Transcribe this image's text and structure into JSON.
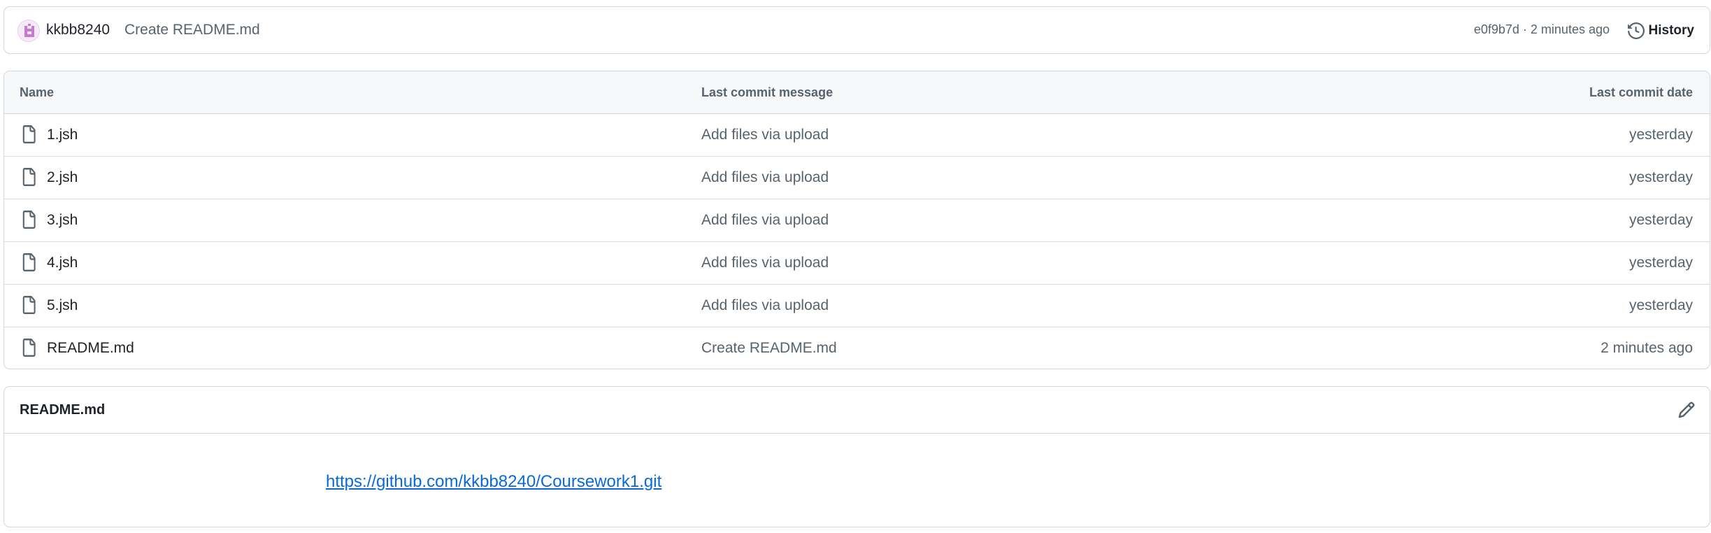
{
  "commit": {
    "author": "kkbb8240",
    "message": "Create README.md",
    "meta": "e0f9b7d · 2 minutes ago",
    "history_label": "History"
  },
  "table": {
    "headers": {
      "name": "Name",
      "message": "Last commit message",
      "date": "Last commit date"
    },
    "rows": [
      {
        "name": "1.jsh",
        "message": "Add files via upload",
        "date": "yesterday"
      },
      {
        "name": "2.jsh",
        "message": "Add files via upload",
        "date": "yesterday"
      },
      {
        "name": "3.jsh",
        "message": "Add files via upload",
        "date": "yesterday"
      },
      {
        "name": "4.jsh",
        "message": "Add files via upload",
        "date": "yesterday"
      },
      {
        "name": "5.jsh",
        "message": "Add files via upload",
        "date": "yesterday"
      },
      {
        "name": "README.md",
        "message": "Create README.md",
        "date": "2 minutes ago"
      }
    ]
  },
  "readme": {
    "title": "README.md",
    "link": "https://github.com/kkbb8240/Coursework1.git"
  },
  "icons": {
    "avatar": "identicon-avatar",
    "history": "history-clock-icon",
    "file": "file-icon",
    "edit": "pencil-icon"
  },
  "colors": {
    "link": "#0969da",
    "border": "#d0d7de",
    "header_bg": "#f6f8fa",
    "muted_text": "#59636e"
  }
}
